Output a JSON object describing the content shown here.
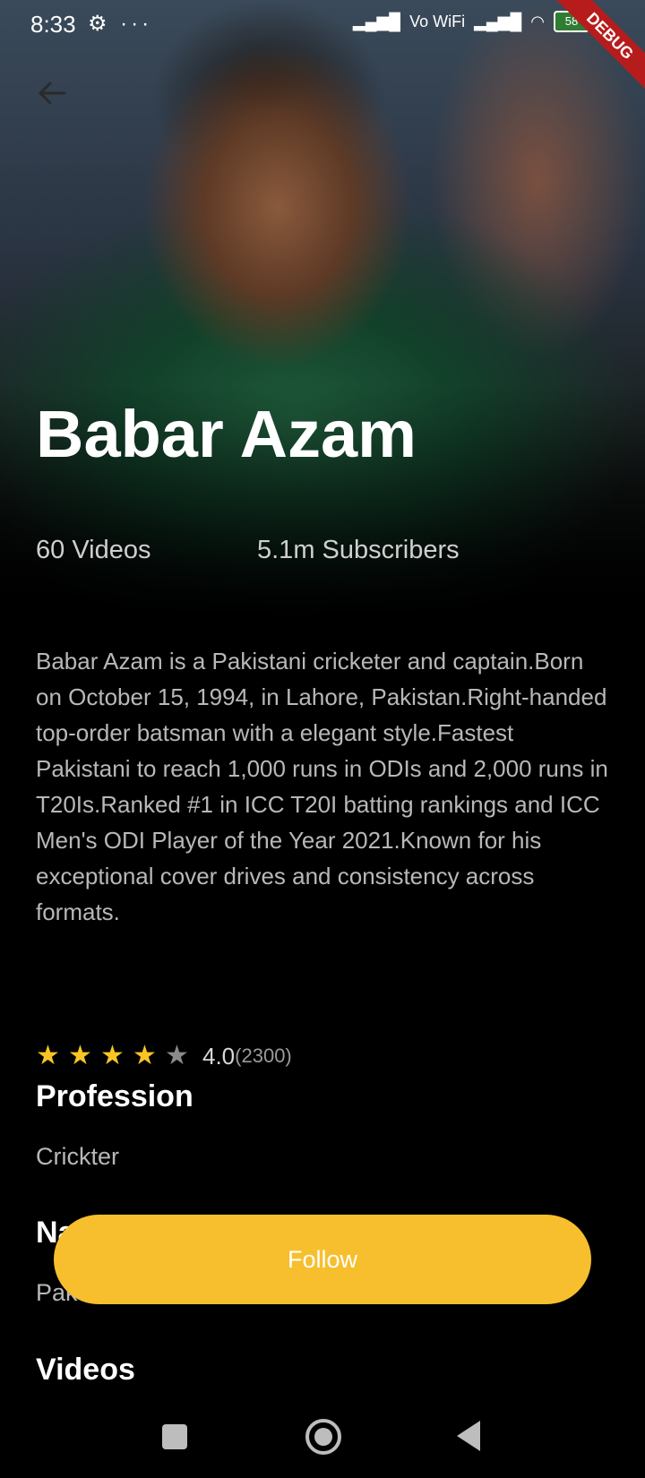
{
  "status_bar": {
    "time": "8:33",
    "left_icons": "⚙ ···",
    "network": "Vo WiFi",
    "battery": "58",
    "debug_banner": "DEBUG"
  },
  "colors": {
    "accent": "#f7bf2e",
    "star_on": "#f7c525",
    "star_off": "#8a8a8a",
    "background": "#000000"
  },
  "header": {
    "back_icon": "arrow-left-icon",
    "name": "Babar Azam",
    "videos": "60 Videos",
    "subscribers": "5.1m Subscribers"
  },
  "description": "Babar Azam is a Pakistani cricketer and captain.Born on October 15, 1994, in Lahore, Pakistan.Right-handed top-order batsman with a elegant style.Fastest Pakistani to reach 1,000 runs in ODIs and 2,000 runs in T20Is.Ranked #1 in ICC T20I batting rankings and ICC Men's ODI Player of the Year 2021.Known for his exceptional cover drives and consistency across formats.",
  "rating": {
    "stars": 4,
    "max_stars": 5,
    "value": "4.0",
    "count": "(2300)"
  },
  "profession": {
    "title": "Profession",
    "value": "Crickter"
  },
  "nationality": {
    "title": "Na",
    "value": "Pak"
  },
  "videos_section": {
    "title": "Videos"
  },
  "follow_button": {
    "label": "Follow"
  },
  "nav_bar": {
    "recents_icon": "square-icon",
    "home_icon": "circle-icon",
    "back_icon": "triangle-back-icon"
  }
}
